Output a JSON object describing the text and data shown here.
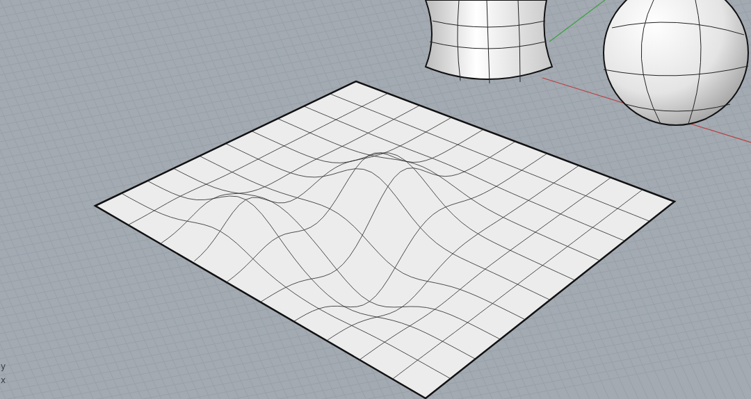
{
  "viewport": {
    "axis_labels": [
      {
        "text": "y"
      },
      {
        "text": "x"
      }
    ]
  }
}
